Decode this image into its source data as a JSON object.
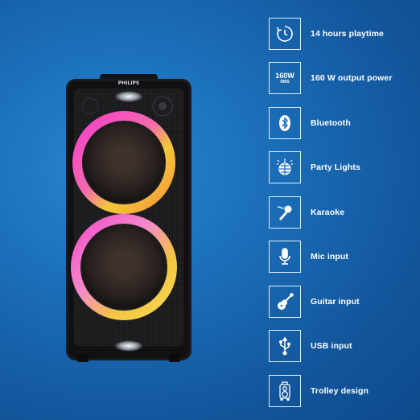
{
  "speaker": {
    "brand": "PHILIPS"
  },
  "features": [
    {
      "icon": "timer-icon",
      "label": "14 hours playtime"
    },
    {
      "icon": "wattage-badge-icon",
      "label": "160 W output power",
      "badge_main": "160W",
      "badge_sub": "RMS"
    },
    {
      "icon": "bluetooth-icon",
      "label": "Bluetooth"
    },
    {
      "icon": "disco-ball-icon",
      "label": "Party Lights"
    },
    {
      "icon": "karaoke-mic-icon",
      "label": "Karaoke"
    },
    {
      "icon": "microphone-icon",
      "label": "Mic input"
    },
    {
      "icon": "guitar-icon",
      "label": "Guitar input"
    },
    {
      "icon": "usb-icon",
      "label": "USB input"
    },
    {
      "icon": "trolley-speaker-icon",
      "label": "Trolley design"
    }
  ],
  "colors": {
    "background": "#1b6fb9",
    "icon_stroke": "#dfeefc",
    "text": "#ffffff",
    "ring_pink": "#ff3fd2",
    "ring_yellow": "#ffd23a"
  }
}
